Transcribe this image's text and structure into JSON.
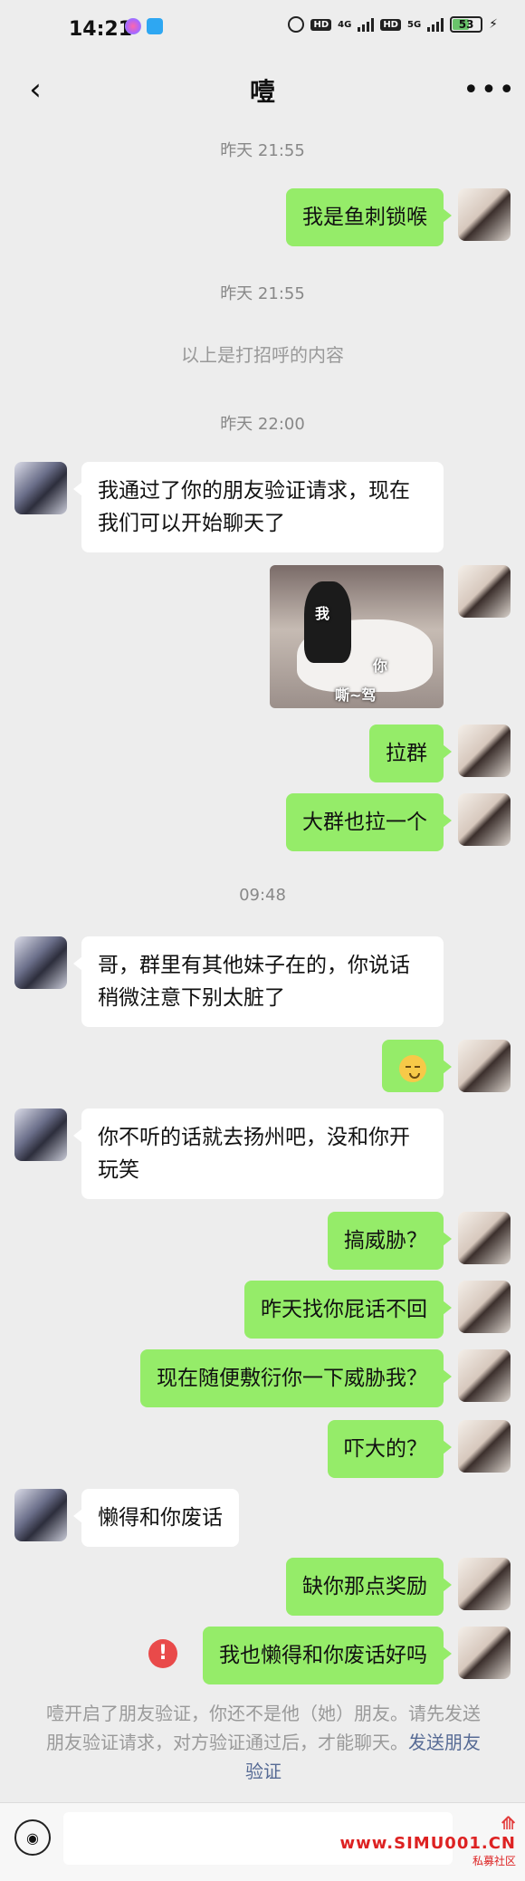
{
  "status_bar": {
    "time": "14:21",
    "battery": "53"
  },
  "header": {
    "title": "噎"
  },
  "messages": [
    {
      "type": "time",
      "text": "昨天 21:55"
    },
    {
      "type": "text",
      "from": "me",
      "text": "我是鱼刺锁喉"
    },
    {
      "type": "time",
      "text": "昨天 21:55"
    },
    {
      "type": "system",
      "text": "以上是打招呼的内容"
    },
    {
      "type": "time",
      "text": "昨天 22:00"
    },
    {
      "type": "text",
      "from": "her",
      "text": "我通过了你的朋友验证请求，现在我们可以开始聊天了"
    },
    {
      "type": "sticker",
      "from": "me",
      "labels": [
        "我",
        "你",
        "嘶~驾"
      ]
    },
    {
      "type": "text",
      "from": "me",
      "text": "拉群"
    },
    {
      "type": "text",
      "from": "me",
      "text": "大群也拉一个"
    },
    {
      "type": "time",
      "text": "09:48"
    },
    {
      "type": "text",
      "from": "her",
      "text": "哥，群里有其他妹子在的，你说话稍微注意下别太脏了"
    },
    {
      "type": "emoji",
      "from": "me",
      "icon": "relieved-face-emoji"
    },
    {
      "type": "text",
      "from": "her",
      "text": "你不听的话就去扬州吧，没和你开玩笑"
    },
    {
      "type": "text",
      "from": "me",
      "text": "搞威胁？"
    },
    {
      "type": "text",
      "from": "me",
      "text": "昨天找你屁话不回"
    },
    {
      "type": "text",
      "from": "me",
      "text": "现在随便敷衍你一下威胁我？"
    },
    {
      "type": "text",
      "from": "me",
      "text": "吓大的？"
    },
    {
      "type": "text",
      "from": "her",
      "text": "懒得和你废话"
    },
    {
      "type": "text",
      "from": "me",
      "text": "缺你那点奖励"
    },
    {
      "type": "text",
      "from": "me",
      "text": "我也懒得和你废话好吗",
      "failed": true,
      "error_mark": "!"
    }
  ],
  "notice": {
    "text": "噎开启了朋友验证，你还不是他（她）朋友。请先发送朋友验证请求，对方验证通过后，才能聊天。",
    "link": "发送朋友验证"
  },
  "watermark": {
    "main": "www.SIMU001.CN",
    "sub": "私募社区"
  },
  "colors": {
    "bubble_me": "#95ec69",
    "bubble_her": "#ffffff",
    "background": "#ededed",
    "link": "#576b95",
    "error": "#e94a4a"
  }
}
